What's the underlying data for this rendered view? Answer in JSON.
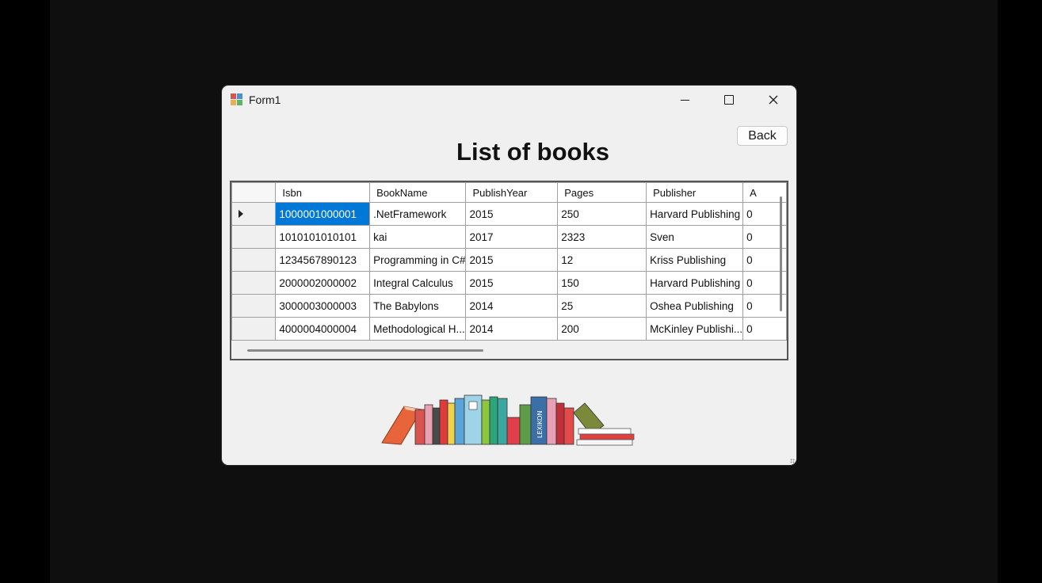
{
  "window": {
    "title": "Form1",
    "app_icon": "winforms-app-icon",
    "minimize_icon": "minimize-icon",
    "maximize_icon": "maximize-icon",
    "close_icon": "close-icon"
  },
  "header": {
    "back_label": "Back",
    "title": "List of books"
  },
  "grid": {
    "columns": [
      "Isbn",
      "BookName",
      "PublishYear",
      "Pages",
      "Publisher",
      "A"
    ],
    "selected_row": 0,
    "selected_color": "#0078d7",
    "rows": [
      [
        "1000001000001",
        ".NetFramework",
        "2015",
        "250",
        "Harvard Publishing",
        "0"
      ],
      [
        "1010101010101",
        "kai",
        "2017",
        "2323",
        "Sven",
        "0"
      ],
      [
        "1234567890123",
        "Programming in C#",
        "2015",
        "12",
        "Kriss Publishing",
        "0"
      ],
      [
        "2000002000002",
        "Integral Calculus",
        "2015",
        "150",
        "Harvard Publishing",
        "0"
      ],
      [
        "3000003000003",
        "The Babylons",
        "2014",
        "25",
        "Oshea Publishing",
        "0"
      ],
      [
        "4000004000004",
        "Methodological H...",
        "2014",
        "200",
        "McKinley Publishi...",
        "0"
      ]
    ]
  },
  "illustration": {
    "icon": "books-illustration",
    "spine_text": "LEXIKON"
  }
}
